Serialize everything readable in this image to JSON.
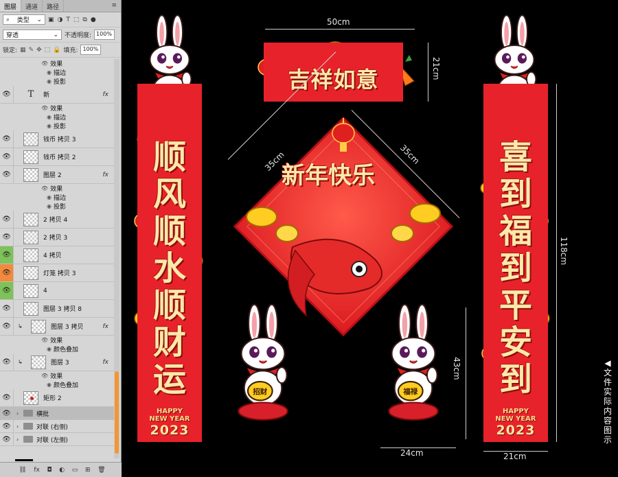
{
  "panel": {
    "tabs": [
      "图层",
      "通道",
      "路径"
    ],
    "filter_select": "类型",
    "blend_mode": "穿透",
    "opacity_label": "不透明度:",
    "opacity_value": "100%",
    "lock_label": "锁定:",
    "fill_label": "填充:",
    "fill_value": "100%"
  },
  "layers": [
    {
      "kind": "sub",
      "icon": "eye",
      "label": "效果"
    },
    {
      "kind": "sub2",
      "label": "描边"
    },
    {
      "kind": "sub2",
      "label": "投影"
    },
    {
      "kind": "text",
      "label": "新",
      "fx": "fx"
    },
    {
      "kind": "sub",
      "icon": "eye",
      "label": "效果"
    },
    {
      "kind": "sub2",
      "label": "描边"
    },
    {
      "kind": "sub2",
      "label": "投影"
    },
    {
      "kind": "layer",
      "label": "钱币 拷贝 3"
    },
    {
      "kind": "layer",
      "label": "钱币 拷贝 2"
    },
    {
      "kind": "layer",
      "label": "图层 2",
      "fx": "fx"
    },
    {
      "kind": "sub",
      "icon": "eye",
      "label": "效果"
    },
    {
      "kind": "sub2",
      "label": "描边"
    },
    {
      "kind": "sub2",
      "label": "投影"
    },
    {
      "kind": "layer",
      "label": "2 拷贝 4"
    },
    {
      "kind": "layer",
      "label": "2 拷贝 3"
    },
    {
      "kind": "layer",
      "label": "4 拷贝",
      "eye": "green"
    },
    {
      "kind": "layer",
      "label": "灯笼 拷贝 3",
      "eye": "orange"
    },
    {
      "kind": "layer",
      "label": "4",
      "eye": "green"
    },
    {
      "kind": "layer",
      "label": "图层 3 拷贝 8"
    },
    {
      "kind": "clip",
      "label": "图层 3 拷贝",
      "fx": "fx"
    },
    {
      "kind": "sub",
      "icon": "eye",
      "label": "效果"
    },
    {
      "kind": "sub2",
      "label": "颜色叠加"
    },
    {
      "kind": "clip",
      "label": "图层 3",
      "fx": "fx"
    },
    {
      "kind": "sub",
      "icon": "eye",
      "label": "效果"
    },
    {
      "kind": "sub2",
      "label": "颜色叠加"
    },
    {
      "kind": "shape",
      "label": "矩形 2"
    },
    {
      "kind": "group",
      "label": "横批",
      "selected": true
    },
    {
      "kind": "group",
      "label": "对联 (右侧)"
    },
    {
      "kind": "group",
      "label": "对联 (左侧)"
    }
  ],
  "bottom_icons": [
    "link-icon",
    "fx",
    "mask-icon",
    "adjust-icon",
    "folder-icon",
    "new-layer-icon",
    "trash-icon"
  ],
  "artwork": {
    "left_couplet": [
      "顺",
      "风",
      "顺",
      "水",
      "顺",
      "财",
      "运"
    ],
    "right_couplet": [
      "喜",
      "到",
      "福",
      "到",
      "平",
      "安",
      "到"
    ],
    "banner": "吉祥如意",
    "diamond": "新年快乐",
    "happy": "HAPPY",
    "new_year": "NEW YEAR",
    "year": "2023",
    "coin_left": "招财",
    "coin_right": "福禄"
  },
  "dimensions": {
    "banner_width": "50cm",
    "banner_height": "21cm",
    "diamond_left": "35cm",
    "diamond_right": "35cm",
    "couplet_height": "118cm",
    "small_height": "43cm",
    "small_width": "24cm",
    "couplet_width": "21cm"
  },
  "caption": [
    "◀",
    "文",
    "件",
    "实",
    "际",
    "内",
    "容",
    "图",
    "示"
  ],
  "colors": {
    "red": "#e8222b",
    "gold": "#ffe9a8",
    "panel": "#d6d6d6",
    "green": "#7dc25a",
    "orange": "#f08a3c"
  }
}
